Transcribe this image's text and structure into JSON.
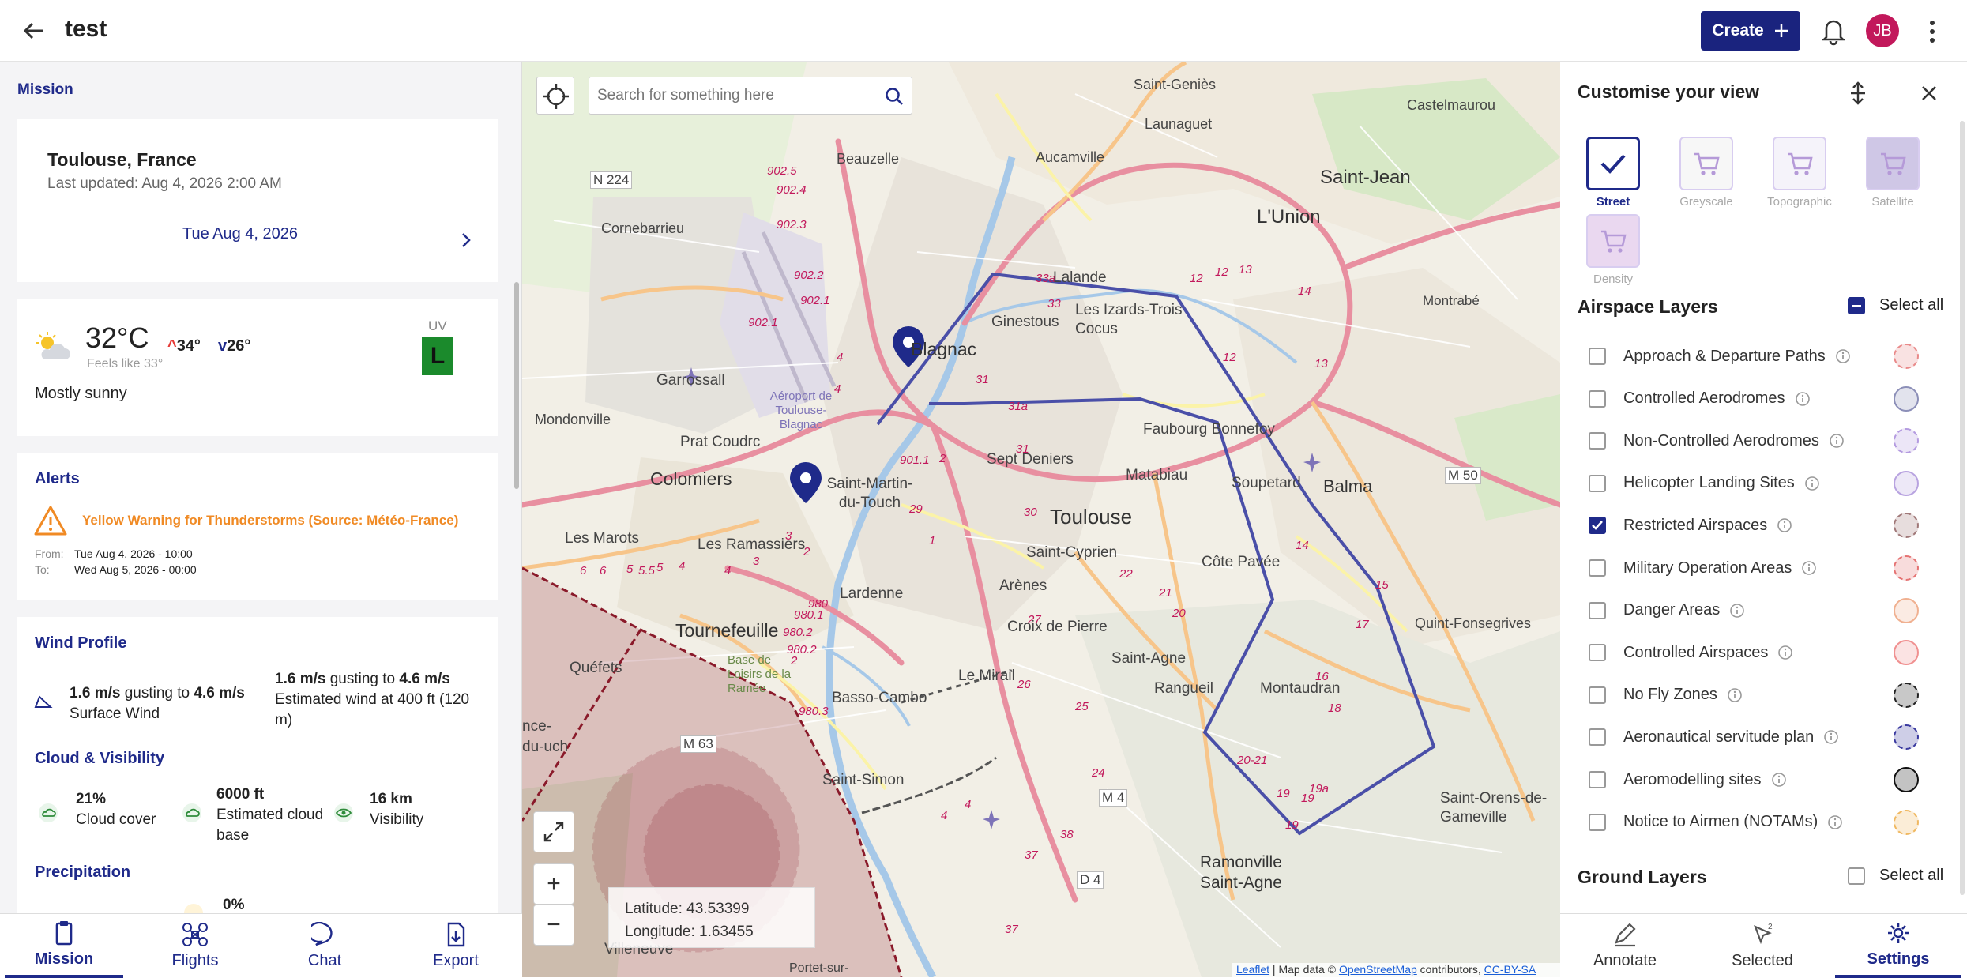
{
  "header": {
    "title": "test",
    "create_label": "Create",
    "avatar_initials": "JB"
  },
  "left": {
    "section_label": "Mission",
    "location": {
      "city": "Toulouse, France",
      "updated": "Last updated: Aug 4, 2026 2:00 AM",
      "date": "Tue Aug 4, 2026"
    },
    "weather": {
      "temp": "32°C",
      "feels": "Feels like 33°",
      "high": "34°",
      "low": "26°",
      "desc": "Mostly sunny",
      "uv_label": "UV",
      "uv_value": "L"
    },
    "alerts": {
      "title": "Alerts",
      "warning": "Yellow Warning for Thunderstorms (Source: Météo-France)",
      "from_label": "From:",
      "from": "Tue Aug 4, 2026 - 10:00",
      "to_label": "To:",
      "to": "Wed Aug 5, 2026 - 00:00"
    },
    "wind": {
      "title": "Wind Profile",
      "surface_speed": "1.6 m/s",
      "surface_gust_word": "gusting to",
      "surface_gust": "4.6 m/s",
      "surface_label": "Surface Wind",
      "alt_speed": "1.6 m/s",
      "alt_gust_word": "gusting to",
      "alt_gust": "4.6 m/s",
      "alt_label": "Estimated wind at 400 ft (120 m)"
    },
    "cloud": {
      "title": "Cloud & Visibility",
      "cover_value": "21%",
      "cover_label": "Cloud cover",
      "base_value": "6000 ft",
      "base_label": "Estimated cloud base",
      "vis_value": "16 km",
      "vis_label": "Visibility"
    },
    "precip": {
      "title": "Precipitation",
      "value": "0%"
    },
    "nav": [
      "Mission",
      "Flights",
      "Chat",
      "Export"
    ]
  },
  "map": {
    "search_placeholder": "Search for something here",
    "latitude": "Latitude: 43.53399",
    "longitude": "Longitude: 1.63455",
    "zoom_in": "+",
    "zoom_out": "−",
    "attribution": {
      "leaflet": "Leaflet",
      "sep": " | Map data © ",
      "osm": "OpenStreetMap",
      "contrib": " contributors, ",
      "license": "CC-BY-SA"
    },
    "labels": {
      "saint_genies": "Saint-Geniès",
      "launaguet": "Launaguet",
      "castelmaurou": "Castelmaurou",
      "beauzelle": "Beauzelle",
      "aucamville": "Aucamville",
      "saint_jean": "Saint-Jean",
      "n224": "N 224",
      "lunion": "L'Union",
      "cornebarrieu": "Cornebarrieu",
      "lalande": "Lalande",
      "izards": "Les Izards-Trois Cocus",
      "ginestous": "Ginestous",
      "blagnac": "Blagnac",
      "montrabe": "Montrabé",
      "garrossall": "Garrossall",
      "aeroport": "Aéroport de Toulouse-Blagnac",
      "mondonville": "Mondonville",
      "prat_coudrc": "Prat Coudrc",
      "faubourg_bonnefoy": "Faubourg Bonnefoy",
      "colomiers": "Colomiers",
      "saint_martin": "Saint-Martin-du-Touch",
      "sept_deniers": "Sept Deniers",
      "matabiau": "Matabiau",
      "soupetard": "Soupetard",
      "balma": "Balma",
      "m50": "M 50",
      "toulouse": "Toulouse",
      "les_marots": "Les Marots",
      "les_ramassiers": "Les Ramassiers",
      "saint_cyprien": "Saint-Cyprien",
      "cote_pavee": "Côte Pavée",
      "lardenne": "Lardenne",
      "arenes": "Arènes",
      "croix_de_pierre": "Croix de Pierre",
      "quint_fonsegrives": "Quint-Fonsegrives",
      "tournefeuille": "Tournefeuille",
      "quefets": "Quéfets",
      "basso_cambo": "Basso-Cambo",
      "le_mirail": "Le Mirail",
      "saint_agne": "Saint-Agne",
      "rangueil": "Rangueil",
      "montaudran": "Montaudran",
      "base_loisirs": "Base de Loisirs de la Ramée",
      "m63": "M 63",
      "saint_simon": "Saint-Simon",
      "m4": "M 4",
      "saint_orens": "Saint-Orens-de-Gameville",
      "plaisance": "nce-du-uch",
      "ramonville": "Ramonville Saint-Agne",
      "d4": "D 4",
      "villeneuve": "Villeneuve",
      "portet": "Portet-sur-"
    }
  },
  "right": {
    "title": "Customise your view",
    "styles": [
      {
        "name": "Street",
        "selected": true
      },
      {
        "name": "Greyscale",
        "selected": false
      },
      {
        "name": "Topographic",
        "selected": false
      },
      {
        "name": "Satellite",
        "selected": false
      },
      {
        "name": "Density",
        "selected": false
      }
    ],
    "airspace_title": "Airspace Layers",
    "select_all": "Select all",
    "layers": [
      {
        "name": "Approach & Departure Paths",
        "checked": false,
        "color": "#e98a8a",
        "dashed": true
      },
      {
        "name": "Controlled Aerodromes",
        "checked": false,
        "color": "#8c8fb8",
        "dashed": false
      },
      {
        "name": "Non-Controlled Aerodromes",
        "checked": false,
        "color": "#b49be0",
        "dashed": true
      },
      {
        "name": "Helicopter Landing Sites",
        "checked": false,
        "color": "#b8a3e0",
        "dashed": false
      },
      {
        "name": "Restricted Airspaces",
        "checked": true,
        "color": "#a07878",
        "dashed": true
      },
      {
        "name": "Military Operation Areas",
        "checked": false,
        "color": "#e57373",
        "dashed": true
      },
      {
        "name": "Danger Areas",
        "checked": false,
        "color": "#f0b090",
        "dashed": false
      },
      {
        "name": "Controlled Airspaces",
        "checked": false,
        "color": "#f09090",
        "dashed": false
      },
      {
        "name": "No Fly Zones",
        "checked": false,
        "color": "#222222",
        "dashed": true
      },
      {
        "name": "Aeronautical servitude plan",
        "checked": false,
        "color": "#3a3aa0",
        "dashed": true
      },
      {
        "name": "Aeromodelling sites",
        "checked": false,
        "color": "#111111",
        "dashed": false
      },
      {
        "name": "Notice to Airmen (NOTAMs)",
        "checked": false,
        "color": "#f0b860",
        "dashed": true
      }
    ],
    "ground_title": "Ground Layers",
    "ground_select_all": "Select all",
    "nav": [
      "Annotate",
      "Selected",
      "Settings"
    ],
    "selected_badge": "2"
  },
  "colors": {
    "brand": "#1f2a8a",
    "warning": "#f08a24",
    "uv": "#1b8a2c",
    "route": "#4a4fa8",
    "restricted": "#8a1a2a"
  }
}
